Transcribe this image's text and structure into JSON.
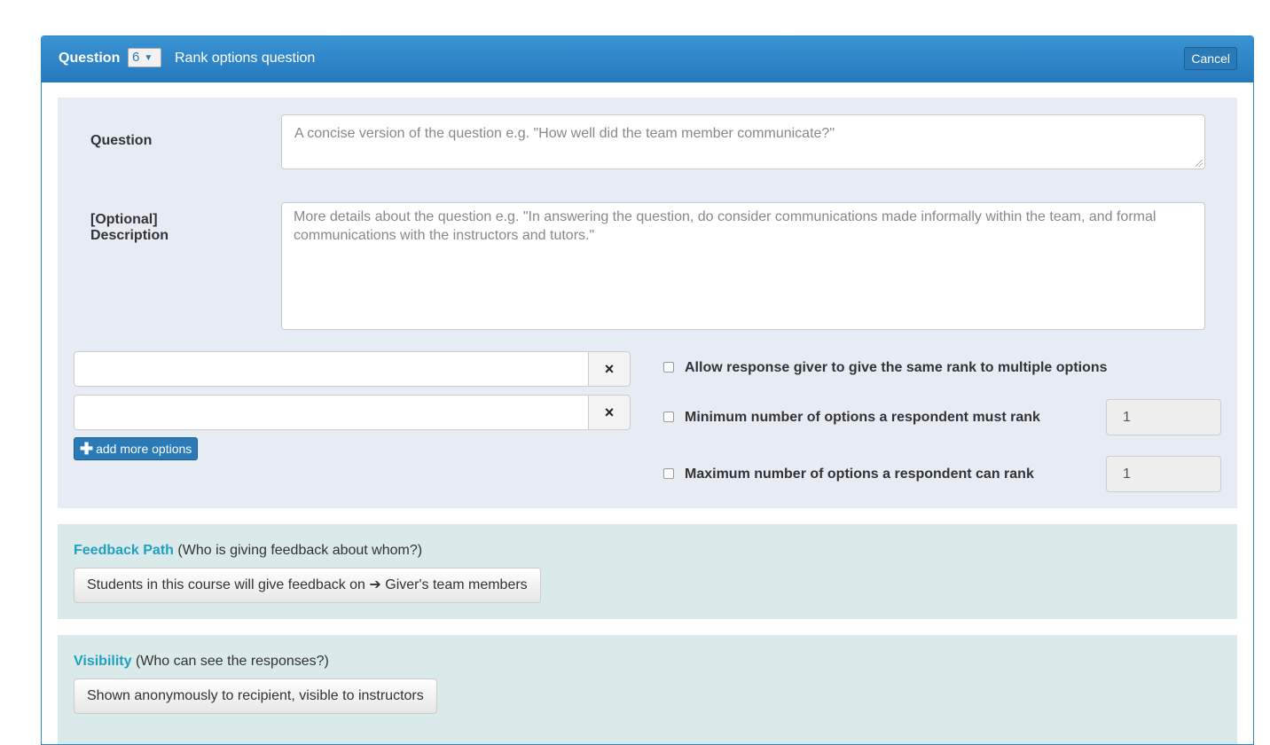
{
  "header": {
    "question_label": "Question",
    "question_number": "6",
    "question_type": "Rank options question",
    "cancel_label": "Cancel"
  },
  "question": {
    "label": "Question",
    "placeholder": "A concise version of the question e.g. \"How well did the team member communicate?\""
  },
  "description": {
    "label": "[Optional] Description",
    "placeholder": "More details about the question e.g. \"In answering the question, do consider communications made informally within the team, and formal communications with the instructors and tutors.\""
  },
  "options": {
    "remove_icon": "×",
    "add_label": "add more options",
    "add_icon": "plus-icon"
  },
  "settings": {
    "allow_same_rank": "Allow response giver to give the same rank to multiple options",
    "min_label": "Minimum number of options a respondent must rank",
    "min_value": "1",
    "max_label": "Maximum number of options a respondent can rank",
    "max_value": "1"
  },
  "feedback_path": {
    "title": "Feedback Path",
    "subtitle": "(Who is giving feedback about whom?)",
    "button_label": "Students in this course will give feedback on ➔ Giver's team members"
  },
  "visibility": {
    "title": "Visibility",
    "subtitle": "(Who can see the responses?)",
    "button_label": "Shown anonymously to recipient, visible to instructors"
  },
  "colors": {
    "header_blue": "#2a7ab8",
    "section_blue": "#e7ecf4",
    "section_teal": "#dae9e9",
    "accent_teal": "#20a0c0"
  }
}
